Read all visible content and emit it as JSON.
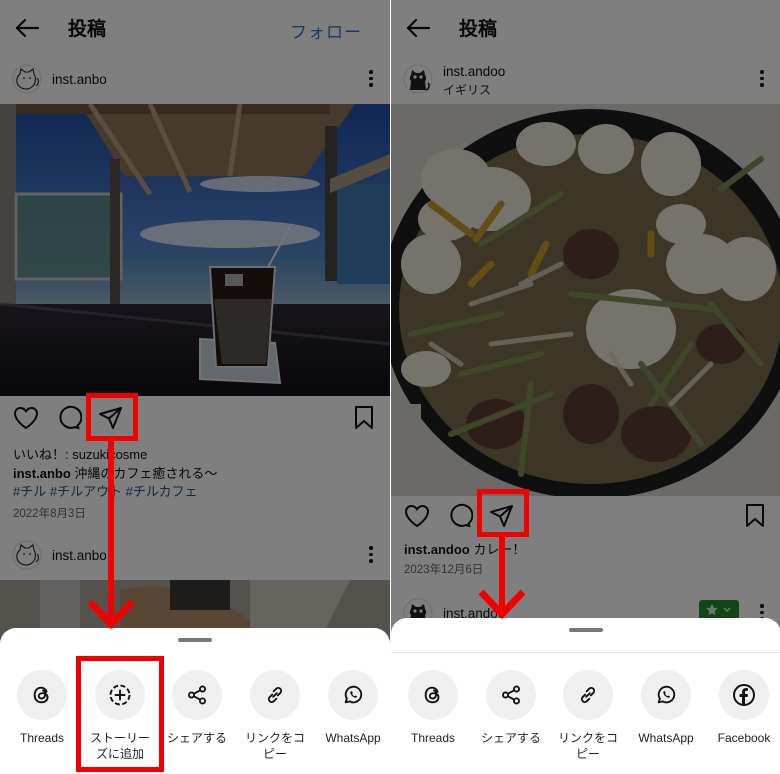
{
  "left": {
    "header": {
      "title": "投稿",
      "follow_label": "フォロー"
    },
    "post1": {
      "username": "inst.anbo",
      "likes": "いいね！: suzukicosme",
      "caption_user": "inst.anbo",
      "caption_text": " 沖縄のカフェ癒される〜",
      "hashtags": "#チル #チルアウト #チルカフェ",
      "date": "2022年8月3日"
    },
    "post2": {
      "username": "inst.anbo"
    },
    "share_sheet": {
      "items": [
        {
          "label": "Threads",
          "icon": "threads-icon"
        },
        {
          "label": "ストーリーズに追加",
          "label_line1": "ストーリー",
          "label_line2": "ズに追加",
          "icon": "add-story-icon"
        },
        {
          "label": "シェアする",
          "icon": "share-icon"
        },
        {
          "label": "リンクをコピー",
          "label_line1": "リンクをコ",
          "label_line2": "ピー",
          "icon": "link-icon"
        },
        {
          "label": "WhatsApp",
          "icon": "whatsapp-icon"
        }
      ]
    }
  },
  "right": {
    "header": {
      "title": "投稿"
    },
    "post1": {
      "username": "inst.andoo",
      "location": "イギリス",
      "caption_user": "inst.andoo",
      "caption_text": " カレー！",
      "date": "2023年12月6日"
    },
    "post2": {
      "username": "inst.andoo"
    },
    "share_sheet": {
      "items": [
        {
          "label": "Threads",
          "icon": "threads-icon"
        },
        {
          "label": "シェアする",
          "icon": "share-icon"
        },
        {
          "label": "リンクをコピー",
          "label_line1": "リンクをコ",
          "label_line2": "ピー",
          "icon": "link-icon"
        },
        {
          "label": "WhatsApp",
          "icon": "whatsapp-icon"
        },
        {
          "label": "Facebook",
          "icon": "facebook-icon"
        }
      ]
    }
  },
  "colors": {
    "annotation_red": "#f20000",
    "follow_blue": "#3b73c7",
    "hashtag_blue": "#2b4f86",
    "badge_green": "#1f8f2e"
  }
}
